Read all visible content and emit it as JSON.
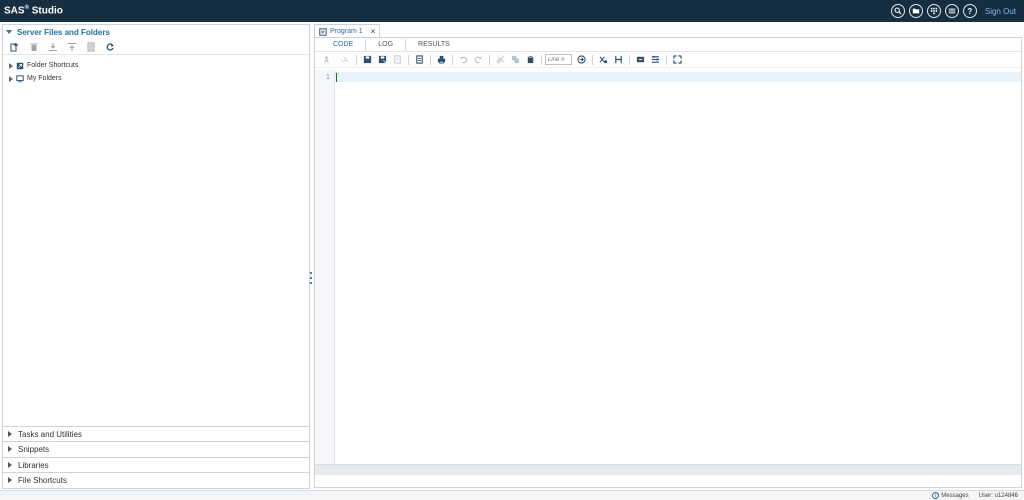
{
  "app": {
    "brand_main": "SAS",
    "brand_reg": "®",
    "brand_rest": " Studio",
    "sign_out": "Sign Out"
  },
  "top_icons": [
    "search-icon",
    "folder-open-icon",
    "apps-grid-icon",
    "menu-icon",
    "help-icon"
  ],
  "left_panel": {
    "title": "Server Files and Folders",
    "toolbar_icons": [
      "new-item-icon",
      "delete-icon",
      "download-icon",
      "upload-icon",
      "properties-icon",
      "refresh-icon"
    ],
    "tree": [
      {
        "label": "Folder Shortcuts",
        "icon": "folder-shortcut-icon"
      },
      {
        "label": "My Folders",
        "icon": "my-folders-icon"
      }
    ],
    "accordions": [
      "Tasks and Utilities",
      "Snippets",
      "Libraries",
      "File Shortcuts"
    ]
  },
  "editor": {
    "tab_label": "Program 1",
    "tab_close": "×",
    "subtabs": [
      "CODE",
      "LOG",
      "RESULTS"
    ],
    "active_subtab": "CODE",
    "toolbar_icons": [
      "run-icon",
      "recent-submissions-icon",
      "save-icon",
      "save-as-icon",
      "export-icon",
      "document-icon",
      "print-icon",
      "undo-icon",
      "redo-icon",
      "cut-icon",
      "copy-icon",
      "paste-icon",
      "goto-line-icon",
      "clear-icon",
      "format-code-icon",
      "add-snippet-icon",
      "options-icon",
      "fullscreen-icon"
    ],
    "line_input_placeholder": "Line #",
    "line_numbers": [
      "1"
    ]
  },
  "status": {
    "messages_label": "Messages",
    "user_label": "User: u124846"
  },
  "colors": {
    "topbar": "#162e42",
    "accent": "#2d6ba3",
    "sign_out": "#7fb6e4"
  }
}
